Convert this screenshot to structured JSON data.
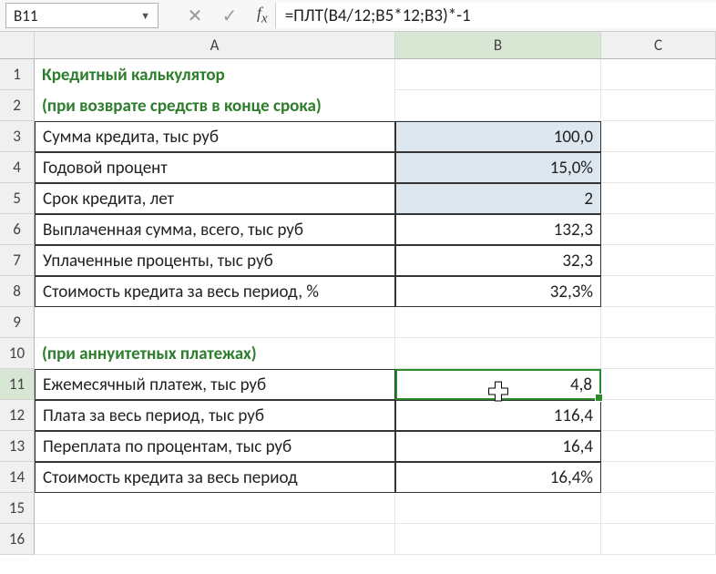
{
  "nameBox": "B11",
  "formula": "=ПЛТ(B4/12;B5*12;B3)*-1",
  "columns": {
    "A": "A",
    "B": "B",
    "C": "C"
  },
  "rows": {
    "1": {
      "A": "Кредитный калькулятор"
    },
    "2": {
      "A": "(при возврате средств в конце срока)"
    },
    "3": {
      "A": "Сумма кредита, тыс руб",
      "B": "100,0"
    },
    "4": {
      "A": "Годовой процент",
      "B": "15,0%"
    },
    "5": {
      "A": "Срок кредита, лет",
      "B": "2"
    },
    "6": {
      "A": "Выплаченная сумма, всего, тыс руб",
      "B": "132,3"
    },
    "7": {
      "A": "Уплаченные проценты, тыс руб",
      "B": "32,3"
    },
    "8": {
      "A": "Стоимость кредита за весь период, %",
      "B": "32,3%"
    },
    "9": {},
    "10": {
      "A": "(при аннуитетных платежах)"
    },
    "11": {
      "A": "Ежемесячный платеж, тыс руб",
      "B": "4,8"
    },
    "12": {
      "A": "Плата за весь период, тыс руб",
      "B": "116,4"
    },
    "13": {
      "A": "Переплата по процентам, тыс руб",
      "B": "16,4"
    },
    "14": {
      "A": "Стоимость кредита за весь период",
      "B": "16,4%"
    },
    "15": {},
    "16": {}
  }
}
